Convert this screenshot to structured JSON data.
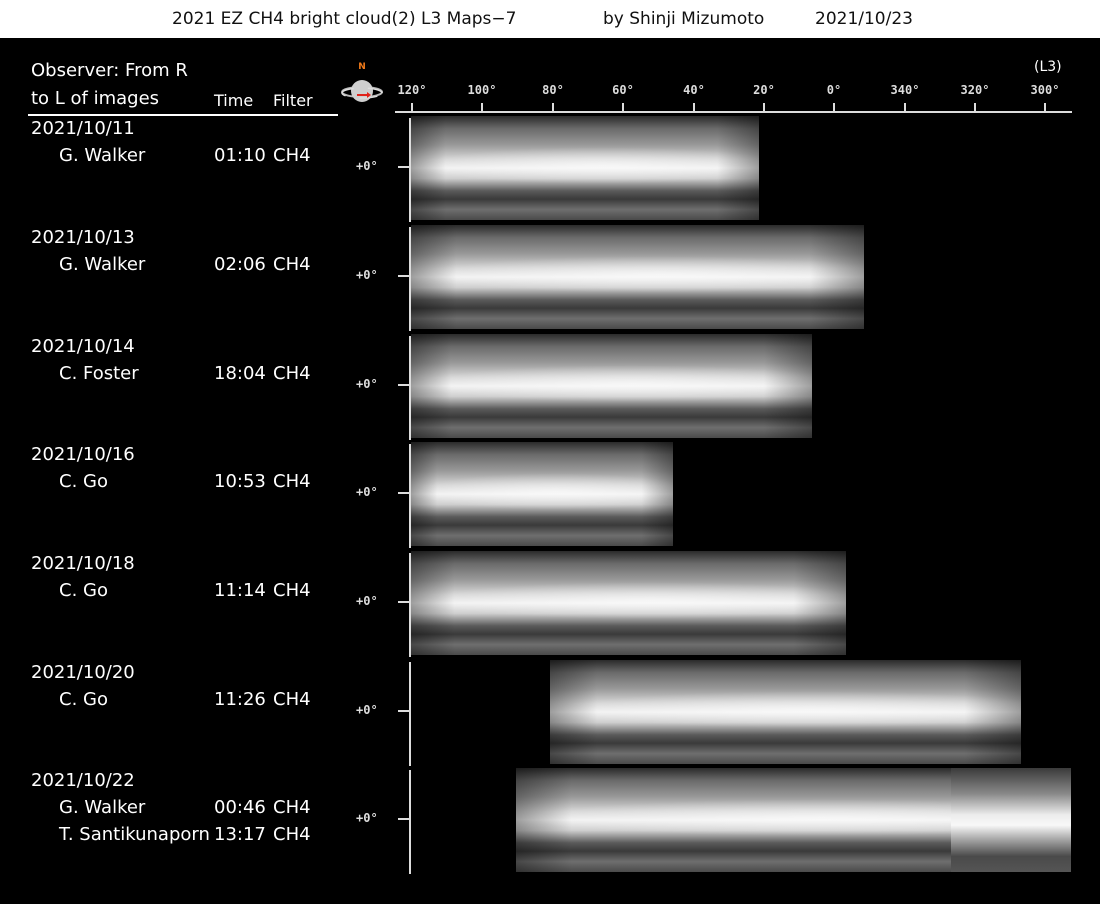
{
  "header": {
    "title": "2021 EZ CH4 bright cloud(2) L3 Maps−7",
    "byline": "by Shinji Mizumoto",
    "date": "2021/10/23"
  },
  "legend": {
    "observer_line1": "Observer: From R",
    "observer_line2": "to L of images",
    "time_col": "Time",
    "filter_col": "Filter"
  },
  "axis": {
    "system": "(L3)",
    "longitudes": [
      "120°",
      "100°",
      "80°",
      "60°",
      "40°",
      "20°",
      "0°",
      "340°",
      "320°",
      "300°"
    ],
    "lat_label": "+0°",
    "north": "N",
    "globe_icon": "planet-orientation-icon"
  },
  "rows": [
    {
      "date": "2021/10/11",
      "observers": [
        {
          "name": "G. Walker",
          "time": "01:10",
          "filter": "CH4"
        }
      ]
    },
    {
      "date": "2021/10/13",
      "observers": [
        {
          "name": "G. Walker",
          "time": "02:06",
          "filter": "CH4"
        }
      ]
    },
    {
      "date": "2021/10/14",
      "observers": [
        {
          "name": "C. Foster",
          "time": "18:04",
          "filter": "CH4"
        }
      ]
    },
    {
      "date": "2021/10/16",
      "observers": [
        {
          "name": "C. Go",
          "time": "10:53",
          "filter": "CH4"
        }
      ]
    },
    {
      "date": "2021/10/18",
      "observers": [
        {
          "name": "C. Go",
          "time": "11:14",
          "filter": "CH4"
        }
      ]
    },
    {
      "date": "2021/10/20",
      "observers": [
        {
          "name": "C. Go",
          "time": "11:26",
          "filter": "CH4"
        }
      ]
    },
    {
      "date": "2021/10/22",
      "observers": [
        {
          "name": "G. Walker",
          "time": "00:46",
          "filter": "CH4"
        },
        {
          "name": "T. Santikunaporn",
          "time": "13:17",
          "filter": "CH4"
        }
      ]
    }
  ]
}
